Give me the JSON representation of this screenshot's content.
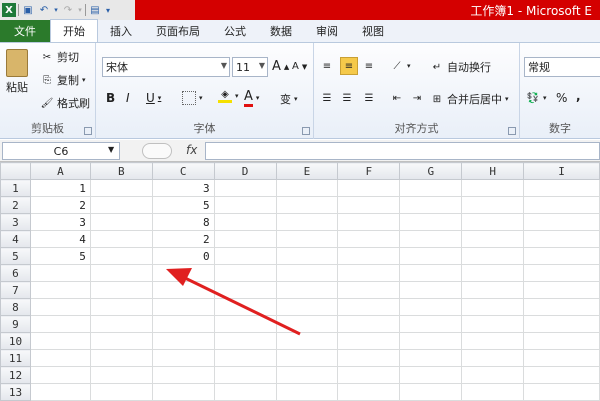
{
  "title": "工作簿1 - Microsoft E",
  "qat": {
    "icons": [
      "excel-icon",
      "save-icon",
      "undo-icon",
      "redo-icon",
      "print-preview-icon",
      "customize-icon"
    ]
  },
  "tabs": [
    {
      "label": "文件"
    },
    {
      "label": "开始"
    },
    {
      "label": "插入"
    },
    {
      "label": "页面布局"
    },
    {
      "label": "公式"
    },
    {
      "label": "数据"
    },
    {
      "label": "审阅"
    },
    {
      "label": "视图"
    }
  ],
  "clipboard": {
    "paste": "粘贴",
    "cut": "剪切",
    "copy": "复制",
    "format_painter": "格式刷",
    "group": "剪贴板"
  },
  "font": {
    "name": "宋体",
    "size": "11",
    "group": "字体",
    "bold": "B",
    "italic": "I",
    "underline": "U",
    "grow": "A",
    "shrink": "A",
    "font_color": "A",
    "phonetic": "变"
  },
  "alignment": {
    "wrap": "自动换行",
    "merge": "合并后居中",
    "group": "对齐方式"
  },
  "number": {
    "format": "常规",
    "group": "数字",
    "percent": "%",
    "comma": ","
  },
  "namebox": "C6",
  "fx": "fx",
  "columns": [
    "A",
    "B",
    "C",
    "D",
    "E",
    "F",
    "G",
    "H",
    "I"
  ],
  "rows": [
    {
      "n": "1",
      "a": "1",
      "c": "3"
    },
    {
      "n": "2",
      "a": "2",
      "c": "5"
    },
    {
      "n": "3",
      "a": "3",
      "c": "8"
    },
    {
      "n": "4",
      "a": "4",
      "c": "2"
    },
    {
      "n": "5",
      "a": "5",
      "c": "0"
    },
    {
      "n": "6",
      "a": "",
      "c": ""
    },
    {
      "n": "7",
      "a": "",
      "c": ""
    },
    {
      "n": "8",
      "a": "",
      "c": ""
    },
    {
      "n": "9",
      "a": "",
      "c": ""
    },
    {
      "n": "10",
      "a": "",
      "c": ""
    },
    {
      "n": "11",
      "a": "",
      "c": ""
    },
    {
      "n": "12",
      "a": "",
      "c": ""
    },
    {
      "n": "13",
      "a": "",
      "c": ""
    }
  ],
  "colors": {
    "title_bar": "#d40000",
    "file_tab": "#2b7a2b",
    "arrow": "#e02020",
    "highlight": "#f5c94a"
  }
}
